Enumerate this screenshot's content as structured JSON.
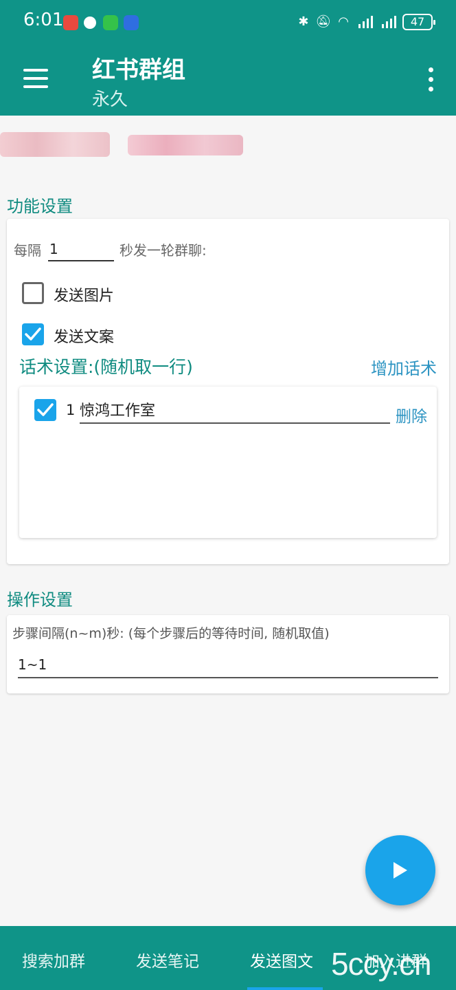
{
  "status_bar": {
    "time": "6:01",
    "battery": "47",
    "icons": [
      "bluetooth-icon",
      "mute-icon",
      "wifi-icon",
      "5g-signal-icon",
      "4g-signal-icon",
      "battery-icon"
    ]
  },
  "app_bar": {
    "title": "红书群组",
    "subtitle": "永久",
    "menu_icon": "hamburger-menu-icon",
    "more_icon": "more-vert-icon"
  },
  "feature_settings": {
    "title": "功能设置",
    "interval_prefix": "每隔",
    "interval_value": "1",
    "interval_suffix": "秒发一轮群聊:",
    "send_image": {
      "label": "发送图片",
      "checked": false
    },
    "send_text": {
      "label": "发送文案",
      "checked": true
    },
    "script_title": "话术设置:(随机取一行)",
    "add_script": "增加话术",
    "scripts": [
      {
        "checked": true,
        "index": "1",
        "text": "惊鸿工作室",
        "delete_label": "删除"
      }
    ]
  },
  "operation_settings": {
    "title": "操作设置",
    "step_label": "步骤间隔(n~m)秒: (每个步骤后的等待时间, 随机取值)",
    "step_value": "1~1"
  },
  "fab": {
    "icon": "play-icon"
  },
  "bottom_nav": {
    "items": [
      "搜索加群",
      "发送笔记",
      "发送图文",
      "加入进群"
    ],
    "active_index": 2
  },
  "watermark": "5ccy.cn",
  "colors": {
    "primary": "#0f9488",
    "accent": "#1aa4ea",
    "link": "#2d94c2"
  }
}
